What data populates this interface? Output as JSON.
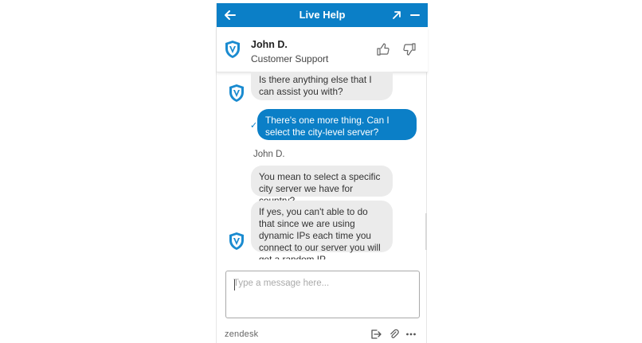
{
  "header": {
    "title": "Live Help",
    "back_icon": "arrow-left-icon",
    "popout_icon": "arrow-up-right-icon",
    "minimize_icon": "minus-icon",
    "color": "#0b7fc7"
  },
  "agent": {
    "name": "John D.",
    "role": "Customer Support",
    "avatar_icon": "shield-logo-icon",
    "rate_good_icon": "thumbs-up-icon",
    "rate_bad_icon": "thumbs-down-icon"
  },
  "messages": [
    {
      "from": "agent",
      "text": "Is there anything else that I can assist you with?"
    },
    {
      "from": "user",
      "text": "There's one more thing. Can I select the city-level server?",
      "status": "sent"
    },
    {
      "from": "agent",
      "sender": "John D.",
      "text": "You mean to select a specific city server we have for country?"
    },
    {
      "from": "agent",
      "text": "If yes, you can't able to do that since we are using dynamic IPs each time you connect to our server you will get a random IP."
    }
  ],
  "composer": {
    "placeholder": "Type a message here...",
    "value": ""
  },
  "footer": {
    "brand": "zendesk",
    "icons": [
      "end-chat-icon",
      "paperclip-icon",
      "more-icon"
    ]
  },
  "colors": {
    "accent": "#0b7fc7",
    "agent_bubble": "#ebebeb",
    "shield_blue": "#1a8bd0"
  }
}
